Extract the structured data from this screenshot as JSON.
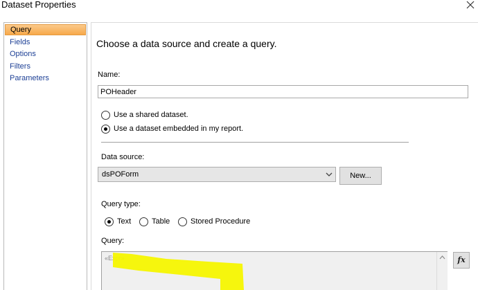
{
  "window": {
    "title": "Dataset Properties"
  },
  "nav": {
    "items": [
      {
        "label": "Query",
        "selected": true
      },
      {
        "label": "Fields",
        "selected": false
      },
      {
        "label": "Options",
        "selected": false
      },
      {
        "label": "Filters",
        "selected": false
      },
      {
        "label": "Parameters",
        "selected": false
      }
    ]
  },
  "main": {
    "heading": "Choose a data source and create a query.",
    "name_label": "Name:",
    "name_value": "POHeader",
    "dataset_options": [
      {
        "label": "Use a shared dataset.",
        "checked": false
      },
      {
        "label": "Use a dataset embedded in my report.",
        "checked": true
      }
    ],
    "data_source_label": "Data source:",
    "data_source_value": "dsPOForm",
    "new_button": "New...",
    "query_type_label": "Query type:",
    "query_types": [
      {
        "label": "Text",
        "checked": true
      },
      {
        "label": "Table",
        "checked": false
      },
      {
        "label": "Stored Procedure",
        "checked": false
      }
    ],
    "query_label": "Query:",
    "query_value": "«Expr»",
    "expression_button": "fx"
  },
  "colors": {
    "selected_nav": "#f7a94a",
    "nav_text": "#1c3f95",
    "highlight": "#f5f500"
  }
}
